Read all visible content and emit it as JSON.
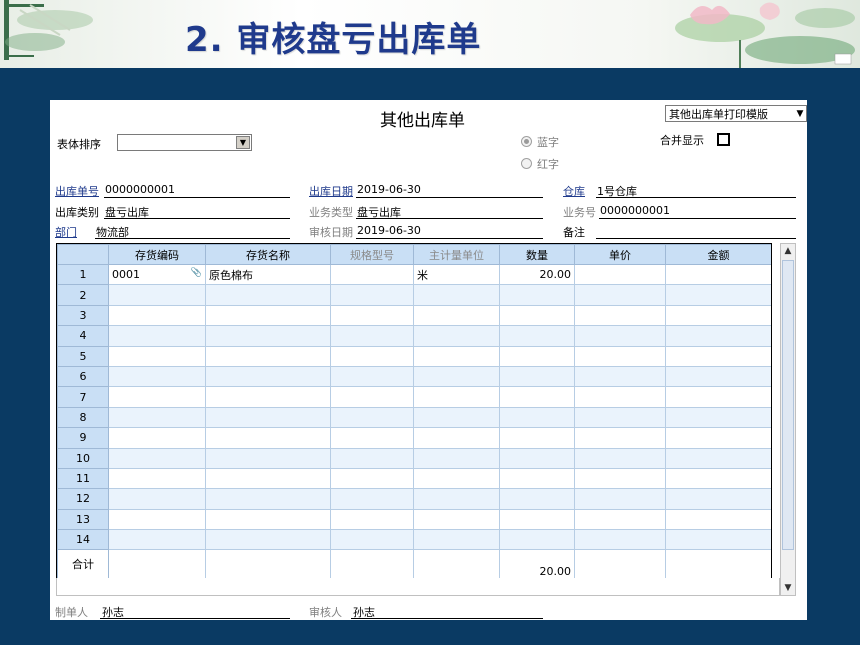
{
  "slide": {
    "title": "2. 审核盘亏出库单"
  },
  "form": {
    "title": "其他出库单",
    "print_template": "其他出库单打印模版",
    "sort_label": "表体排序",
    "sort_value": "",
    "radio_blue": "蓝字",
    "radio_red": "红字",
    "merge_label": "合并显示",
    "fields": {
      "doc_no_label": "出库单号",
      "doc_no": "0000000001",
      "out_date_label": "出库日期",
      "out_date": "2019-06-30",
      "warehouse_label": "仓库",
      "warehouse": "1号仓库",
      "out_type_label": "出库类别",
      "out_type": "盘亏出库",
      "biz_type_label": "业务类型",
      "biz_type": "盘亏出库",
      "biz_no_label": "业务号",
      "biz_no": "0000000001",
      "dept_label": "部门",
      "dept": "物流部",
      "audit_date_label": "审核日期",
      "audit_date": "2019-06-30",
      "remark_label": "备注",
      "remark": ""
    },
    "table": {
      "headers": [
        "存货编码",
        "存货名称",
        "规格型号",
        "主计量单位",
        "数量",
        "单价",
        "金额"
      ],
      "rows": [
        {
          "n": "1",
          "code": "0001",
          "name": "原色棉布",
          "spec": "",
          "unit": "米",
          "qty": "20.00",
          "price": "",
          "amount": ""
        },
        {
          "n": "2"
        },
        {
          "n": "3"
        },
        {
          "n": "4"
        },
        {
          "n": "5"
        },
        {
          "n": "6"
        },
        {
          "n": "7"
        },
        {
          "n": "8"
        },
        {
          "n": "9"
        },
        {
          "n": "10"
        },
        {
          "n": "11"
        },
        {
          "n": "12"
        },
        {
          "n": "13"
        },
        {
          "n": "14"
        }
      ],
      "total_label": "合计",
      "total_qty": "20.00"
    },
    "footer": {
      "maker_label": "制单人",
      "maker": "孙志",
      "auditor_label": "审核人",
      "auditor": "孙志"
    }
  }
}
